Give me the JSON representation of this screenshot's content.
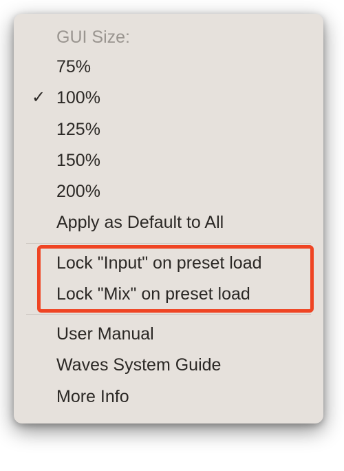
{
  "menu": {
    "header": "GUI Size:",
    "sizes": [
      {
        "label": "75%",
        "checked": false
      },
      {
        "label": "100%",
        "checked": true
      },
      {
        "label": "125%",
        "checked": false
      },
      {
        "label": "150%",
        "checked": false
      },
      {
        "label": "200%",
        "checked": false
      }
    ],
    "apply_default": "Apply as Default to All",
    "lock_items": [
      "Lock \"Input\" on preset load",
      "Lock \"Mix\" on preset load"
    ],
    "help_items": [
      "User Manual",
      "Waves System Guide",
      "More Info"
    ],
    "checkmark_glyph": "✓"
  },
  "highlight": {
    "color": "#ef4423"
  }
}
